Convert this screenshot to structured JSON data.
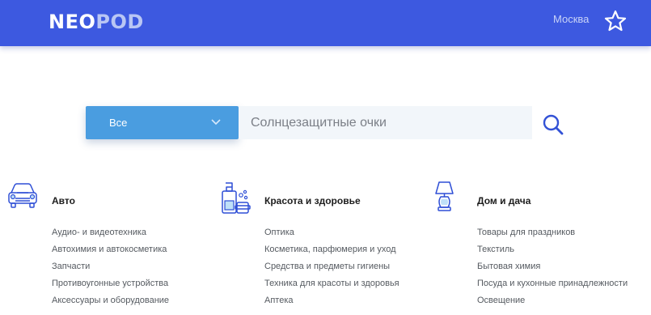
{
  "header": {
    "logo_part1": "NEO",
    "logo_part2": "POD",
    "city": "Москва",
    "favorites_icon": "star-icon",
    "colors": {
      "background": "#3d59e0",
      "logo_accent": "#b9c6f4"
    }
  },
  "search": {
    "category_value": "Все",
    "category_icon": "chevron-down-icon",
    "placeholder": "Солнцезащитные очки",
    "search_icon": "search-icon",
    "colors": {
      "select_bg": "#4a9de0",
      "input_bg": "#f2f6fa"
    }
  },
  "categories": [
    {
      "icon": "car-icon",
      "title": "Авто",
      "links": [
        "Аудио- и видеотехника",
        "Автохимия и автокосметика",
        "Запчасти",
        "Противоугонные устройства",
        "Аксессуары и оборудование"
      ]
    },
    {
      "icon": "cosmetics-bottle-icon",
      "title": "Красота и здоровье",
      "links": [
        "Оптика",
        "Косметика, парфюмерия и уход",
        "Средства и предметы гигиены",
        "Техника для красоты и здоровья",
        "Аптека"
      ]
    },
    {
      "icon": "table-lamp-icon",
      "title": "Дом и дача",
      "links": [
        "Товары для праздников",
        "Текстиль",
        "Бытовая химия",
        "Посуда и кухонные принадлежности",
        "Освещение"
      ]
    }
  ]
}
